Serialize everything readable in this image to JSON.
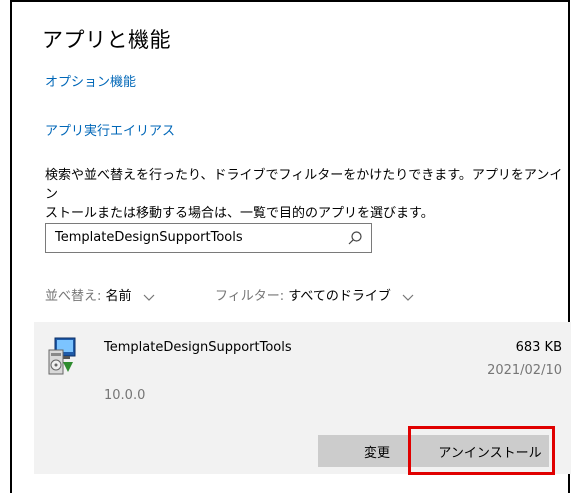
{
  "page": {
    "title": "アプリと機能",
    "links": [
      "オプション機能",
      "アプリ実行エイリアス"
    ],
    "description_lines": [
      "検索や並べ替えを行ったり、ドライブでフィルターをかけたりできます。アプリをアンイン",
      "ストールまたは移動する場合は、一覧で目的のアプリを選びます。"
    ]
  },
  "search": {
    "value": "TemplateDesignSupportTools",
    "icon": "search-icon"
  },
  "sort": {
    "label": "並べ替え: ",
    "value": "名前"
  },
  "filter": {
    "label": "フィルター: ",
    "value": "すべてのドライブ"
  },
  "app": {
    "name": "TemplateDesignSupportTools",
    "size": "683 KB",
    "date": "2021/02/10",
    "version": "10.0.0",
    "icon": "installer-icon"
  },
  "buttons": {
    "modify": "変更",
    "uninstall": "アンインストール"
  },
  "colors": {
    "link": "#0067b8",
    "card_bg": "#f2f2f2",
    "button_bg": "#cccccc",
    "highlight": "#e00000"
  }
}
